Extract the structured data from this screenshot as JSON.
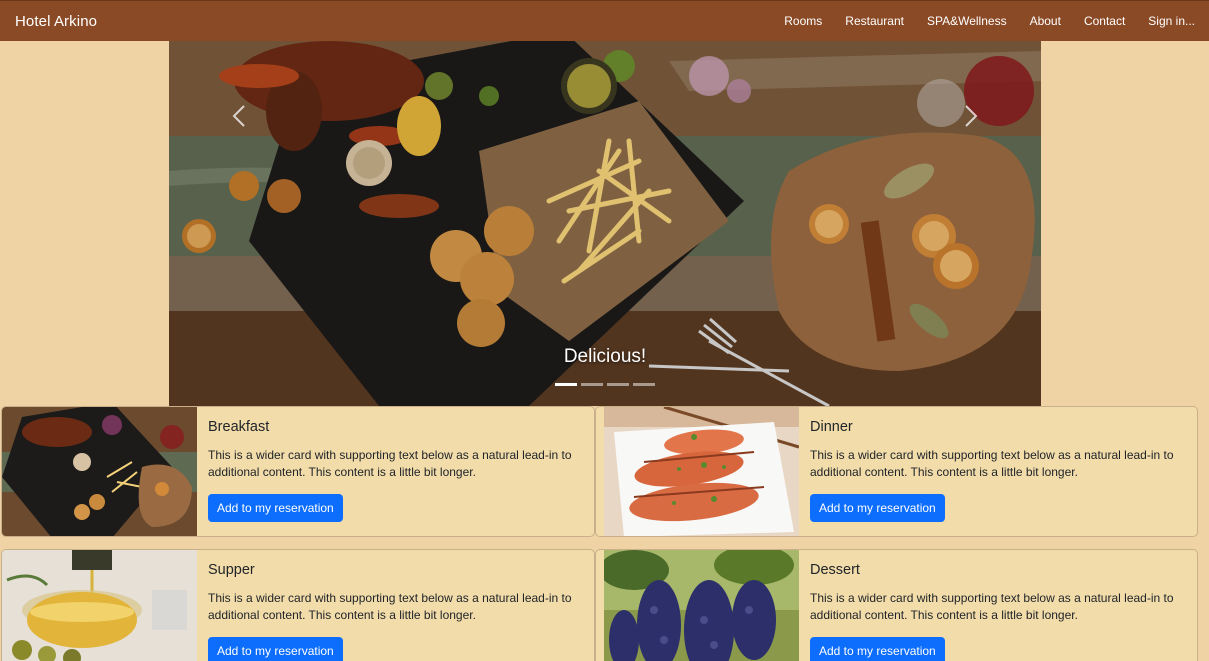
{
  "navbar": {
    "brand": "Hotel Arkino",
    "links": [
      "Rooms",
      "Restaurant",
      "SPA&Wellness",
      "About",
      "Contact",
      "Sign in..."
    ],
    "background": "#8b4a26"
  },
  "carousel": {
    "caption": "Delicious!",
    "slide_count": 4,
    "active_index": 0,
    "prev_icon": "chevron-left-icon",
    "next_icon": "chevron-right-icon"
  },
  "cards": [
    {
      "title": "Breakfast",
      "text": "This is a wider card with supporting text below as a natural lead-in to additional content. This content is a little bit longer.",
      "button": "Add to my reservation"
    },
    {
      "title": "Dinner",
      "text": "This is a wider card with supporting text below as a natural lead-in to additional content. This content is a little bit longer.",
      "button": "Add to my reservation"
    },
    {
      "title": "Supper",
      "text": "This is a wider card with supporting text below as a natural lead-in to additional content. This content is a little bit longer.",
      "button": "Add to my reservation"
    },
    {
      "title": "Dessert",
      "text": "This is a wider card with supporting text below as a natural lead-in to additional content. This content is a little bit longer.",
      "button": "Add to my reservation"
    }
  ],
  "colors": {
    "page_bg": "#f0d3a4",
    "card_bg": "#f2dcaa",
    "button": "#0d6efd"
  }
}
